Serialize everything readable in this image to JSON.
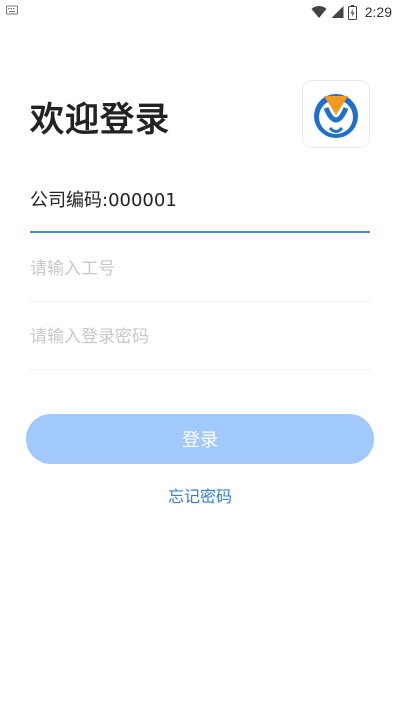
{
  "status_bar": {
    "left_icon": "keyboard-icon",
    "icons": [
      "wifi-icon",
      "cellular-signal-icon",
      "battery-icon"
    ],
    "time": "2:29"
  },
  "header": {
    "title": "欢迎登录",
    "logo_icon": "app-logo-icon",
    "logo_colors": {
      "orange": "#f29a1f",
      "blue": "#1f6fd1"
    }
  },
  "form": {
    "company_label": "公司编码:",
    "company_code": "000001",
    "employee_id": {
      "value": "",
      "placeholder": "请输入工号"
    },
    "password": {
      "value": "",
      "placeholder": "请输入登录密码"
    }
  },
  "actions": {
    "login_label": "登录",
    "forgot_password_label": "忘记密码"
  },
  "colors": {
    "accent": "#3a8ee6",
    "button_bg": "#a1c9fb",
    "link": "#2f7fd9"
  }
}
